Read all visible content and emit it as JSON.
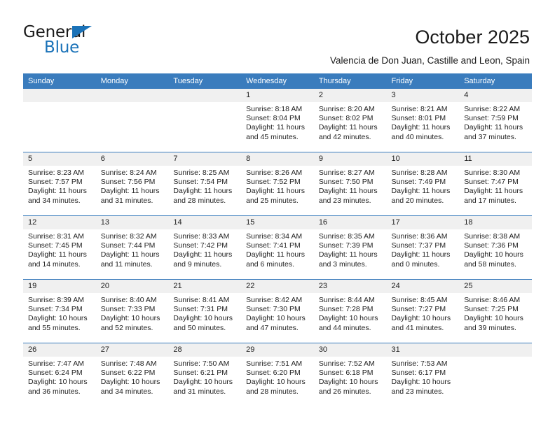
{
  "brand": {
    "name_part1": "General",
    "name_part2": "Blue",
    "accent_color": "#1a72b8"
  },
  "header": {
    "title": "October 2025",
    "subtitle": "Valencia de Don Juan, Castille and Leon, Spain"
  },
  "theme": {
    "header_row_bg": "#3a7cbd",
    "daynum_bg": "#f0f0f0",
    "text_color": "#222222"
  },
  "calendar": {
    "weekday_headers": [
      "Sunday",
      "Monday",
      "Tuesday",
      "Wednesday",
      "Thursday",
      "Friday",
      "Saturday"
    ],
    "weeks": [
      [
        {
          "day": "",
          "lines": []
        },
        {
          "day": "",
          "lines": []
        },
        {
          "day": "",
          "lines": []
        },
        {
          "day": "1",
          "lines": [
            "Sunrise: 8:18 AM",
            "Sunset: 8:04 PM",
            "Daylight: 11 hours and 45 minutes."
          ]
        },
        {
          "day": "2",
          "lines": [
            "Sunrise: 8:20 AM",
            "Sunset: 8:02 PM",
            "Daylight: 11 hours and 42 minutes."
          ]
        },
        {
          "day": "3",
          "lines": [
            "Sunrise: 8:21 AM",
            "Sunset: 8:01 PM",
            "Daylight: 11 hours and 40 minutes."
          ]
        },
        {
          "day": "4",
          "lines": [
            "Sunrise: 8:22 AM",
            "Sunset: 7:59 PM",
            "Daylight: 11 hours and 37 minutes."
          ]
        }
      ],
      [
        {
          "day": "5",
          "lines": [
            "Sunrise: 8:23 AM",
            "Sunset: 7:57 PM",
            "Daylight: 11 hours and 34 minutes."
          ]
        },
        {
          "day": "6",
          "lines": [
            "Sunrise: 8:24 AM",
            "Sunset: 7:56 PM",
            "Daylight: 11 hours and 31 minutes."
          ]
        },
        {
          "day": "7",
          "lines": [
            "Sunrise: 8:25 AM",
            "Sunset: 7:54 PM",
            "Daylight: 11 hours and 28 minutes."
          ]
        },
        {
          "day": "8",
          "lines": [
            "Sunrise: 8:26 AM",
            "Sunset: 7:52 PM",
            "Daylight: 11 hours and 25 minutes."
          ]
        },
        {
          "day": "9",
          "lines": [
            "Sunrise: 8:27 AM",
            "Sunset: 7:50 PM",
            "Daylight: 11 hours and 23 minutes."
          ]
        },
        {
          "day": "10",
          "lines": [
            "Sunrise: 8:28 AM",
            "Sunset: 7:49 PM",
            "Daylight: 11 hours and 20 minutes."
          ]
        },
        {
          "day": "11",
          "lines": [
            "Sunrise: 8:30 AM",
            "Sunset: 7:47 PM",
            "Daylight: 11 hours and 17 minutes."
          ]
        }
      ],
      [
        {
          "day": "12",
          "lines": [
            "Sunrise: 8:31 AM",
            "Sunset: 7:45 PM",
            "Daylight: 11 hours and 14 minutes."
          ]
        },
        {
          "day": "13",
          "lines": [
            "Sunrise: 8:32 AM",
            "Sunset: 7:44 PM",
            "Daylight: 11 hours and 11 minutes."
          ]
        },
        {
          "day": "14",
          "lines": [
            "Sunrise: 8:33 AM",
            "Sunset: 7:42 PM",
            "Daylight: 11 hours and 9 minutes."
          ]
        },
        {
          "day": "15",
          "lines": [
            "Sunrise: 8:34 AM",
            "Sunset: 7:41 PM",
            "Daylight: 11 hours and 6 minutes."
          ]
        },
        {
          "day": "16",
          "lines": [
            "Sunrise: 8:35 AM",
            "Sunset: 7:39 PM",
            "Daylight: 11 hours and 3 minutes."
          ]
        },
        {
          "day": "17",
          "lines": [
            "Sunrise: 8:36 AM",
            "Sunset: 7:37 PM",
            "Daylight: 11 hours and 0 minutes."
          ]
        },
        {
          "day": "18",
          "lines": [
            "Sunrise: 8:38 AM",
            "Sunset: 7:36 PM",
            "Daylight: 10 hours and 58 minutes."
          ]
        }
      ],
      [
        {
          "day": "19",
          "lines": [
            "Sunrise: 8:39 AM",
            "Sunset: 7:34 PM",
            "Daylight: 10 hours and 55 minutes."
          ]
        },
        {
          "day": "20",
          "lines": [
            "Sunrise: 8:40 AM",
            "Sunset: 7:33 PM",
            "Daylight: 10 hours and 52 minutes."
          ]
        },
        {
          "day": "21",
          "lines": [
            "Sunrise: 8:41 AM",
            "Sunset: 7:31 PM",
            "Daylight: 10 hours and 50 minutes."
          ]
        },
        {
          "day": "22",
          "lines": [
            "Sunrise: 8:42 AM",
            "Sunset: 7:30 PM",
            "Daylight: 10 hours and 47 minutes."
          ]
        },
        {
          "day": "23",
          "lines": [
            "Sunrise: 8:44 AM",
            "Sunset: 7:28 PM",
            "Daylight: 10 hours and 44 minutes."
          ]
        },
        {
          "day": "24",
          "lines": [
            "Sunrise: 8:45 AM",
            "Sunset: 7:27 PM",
            "Daylight: 10 hours and 41 minutes."
          ]
        },
        {
          "day": "25",
          "lines": [
            "Sunrise: 8:46 AM",
            "Sunset: 7:25 PM",
            "Daylight: 10 hours and 39 minutes."
          ]
        }
      ],
      [
        {
          "day": "26",
          "lines": [
            "Sunrise: 7:47 AM",
            "Sunset: 6:24 PM",
            "Daylight: 10 hours and 36 minutes."
          ]
        },
        {
          "day": "27",
          "lines": [
            "Sunrise: 7:48 AM",
            "Sunset: 6:22 PM",
            "Daylight: 10 hours and 34 minutes."
          ]
        },
        {
          "day": "28",
          "lines": [
            "Sunrise: 7:50 AM",
            "Sunset: 6:21 PM",
            "Daylight: 10 hours and 31 minutes."
          ]
        },
        {
          "day": "29",
          "lines": [
            "Sunrise: 7:51 AM",
            "Sunset: 6:20 PM",
            "Daylight: 10 hours and 28 minutes."
          ]
        },
        {
          "day": "30",
          "lines": [
            "Sunrise: 7:52 AM",
            "Sunset: 6:18 PM",
            "Daylight: 10 hours and 26 minutes."
          ]
        },
        {
          "day": "31",
          "lines": [
            "Sunrise: 7:53 AM",
            "Sunset: 6:17 PM",
            "Daylight: 10 hours and 23 minutes."
          ]
        },
        {
          "day": "",
          "lines": []
        }
      ]
    ]
  }
}
